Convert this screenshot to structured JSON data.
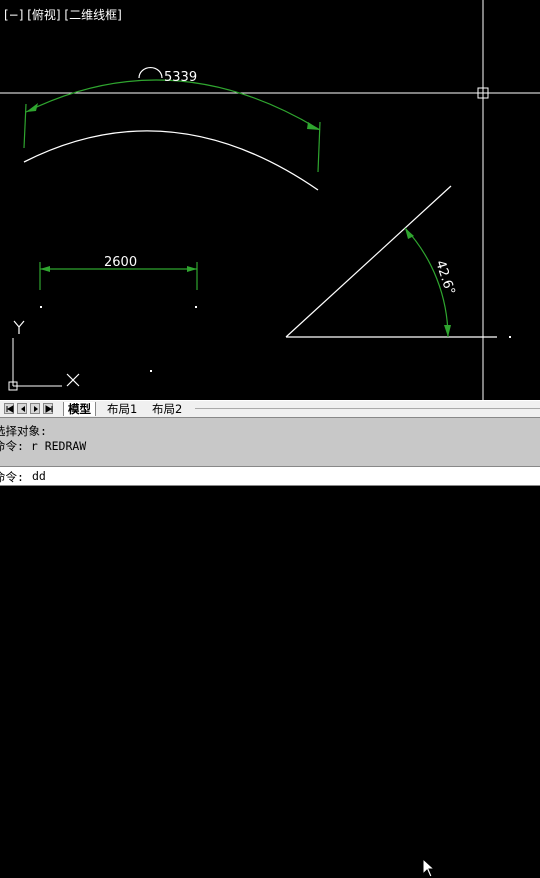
{
  "viewport": {
    "label": "[−] [俯视] [二维线框]",
    "colors": {
      "background": "#000000",
      "geometry": "#ffffff",
      "dimension": "#2fa52f"
    }
  },
  "drawing": {
    "arc_length_dimension": "5339",
    "linear_dimension": "2600",
    "angular_dimension": "42.6°",
    "ucs_axis_labels": {
      "x": "X",
      "y": "Y"
    }
  },
  "layout_tabs": {
    "nav_icons": [
      "first-icon",
      "previous-icon",
      "next-icon",
      "last-icon"
    ],
    "tabs": [
      {
        "label": "模型",
        "active": true
      },
      {
        "label": "布局1",
        "active": false
      },
      {
        "label": "布局2",
        "active": false
      }
    ]
  },
  "command": {
    "history": [
      "选择对象:",
      "命令: r REDRAW"
    ],
    "prompt": "命令:",
    "input_value": "dd"
  }
}
